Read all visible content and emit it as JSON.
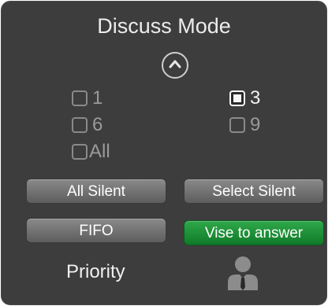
{
  "title": "Discuss Mode",
  "collapse_icon": "chevron-up-icon",
  "checkboxes": [
    {
      "label": "1",
      "checked": false
    },
    {
      "label": "3",
      "checked": true
    },
    {
      "label": "6",
      "checked": false
    },
    {
      "label": "9",
      "checked": false
    },
    {
      "label": "All",
      "checked": false
    }
  ],
  "buttons": {
    "all_silent": "All Silent",
    "select_silent": "Select Silent",
    "fifo": "FIFO",
    "vise_to_answer": "Vise to answer"
  },
  "priority_label": "Priority",
  "person_icon": "presenter-icon",
  "colors": {
    "panel_bg": "#3d3d3d",
    "accent_green": "#1f8f36",
    "button_gray": "#737373"
  }
}
